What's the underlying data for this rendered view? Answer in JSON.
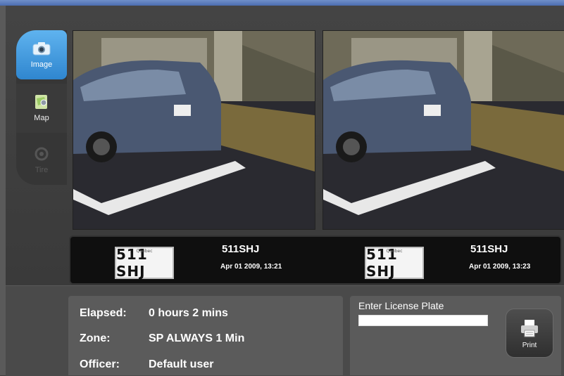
{
  "sidebar": {
    "items": [
      {
        "label": "Image",
        "icon": "camera-icon",
        "state": "active"
      },
      {
        "label": "Map",
        "icon": "map-icon",
        "state": "normal"
      },
      {
        "label": "Tire",
        "icon": "tire-icon",
        "state": "disabled"
      }
    ]
  },
  "plates": [
    {
      "plate_image_text": "511 SHJ",
      "province_text": "Québec",
      "number": "511SHJ",
      "timestamp": "Apr 01 2009, 13:21"
    },
    {
      "plate_image_text": "511 SHJ",
      "province_text": "Québec",
      "number": "511SHJ",
      "timestamp": "Apr 01 2009, 13:23"
    }
  ],
  "info": {
    "elapsed_label": "Elapsed:",
    "elapsed_value": "0 hours 2 mins",
    "zone_label": "Zone:",
    "zone_value": "SP ALWAYS 1 Min",
    "officer_label": "Officer:",
    "officer_value": "Default user"
  },
  "license_entry": {
    "title": "Enter License Plate",
    "value": "",
    "placeholder": ""
  },
  "print": {
    "label": "Print",
    "icon": "printer-icon"
  },
  "colors": {
    "accent": "#3a98dc",
    "panel": "#5b5b5b",
    "background": "#3f3f3f"
  }
}
